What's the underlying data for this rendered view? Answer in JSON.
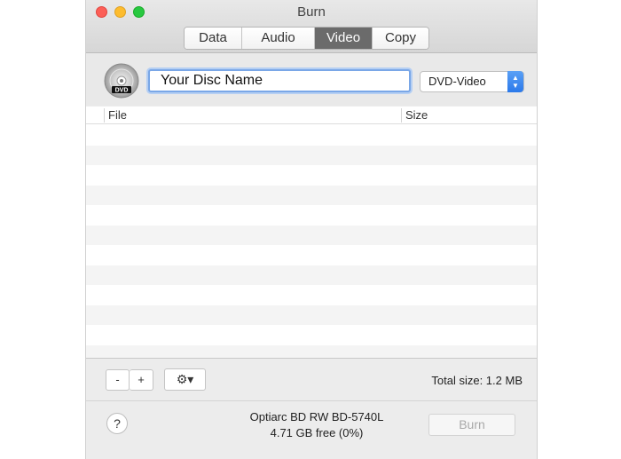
{
  "window": {
    "title": "Burn"
  },
  "tabs": [
    {
      "label": "Data"
    },
    {
      "label": "Audio"
    },
    {
      "label": "Video"
    },
    {
      "label": "Copy"
    }
  ],
  "active_tab": "Video",
  "disc": {
    "name_value": "Your Disc Name",
    "icon_label": "DVD",
    "type_selected": "DVD-Video"
  },
  "table": {
    "columns": [
      "File",
      "Size"
    ],
    "rows": []
  },
  "toolbar": {
    "remove_label": "-",
    "add_label": "+",
    "gear_label": "⚙▾",
    "total_size": "Total size: 1.2 MB"
  },
  "footer": {
    "help_label": "?",
    "drive_name": "Optiarc BD RW BD-5740L",
    "drive_free": "4.71 GB free (0%)",
    "burn_label": "Burn"
  },
  "colors": {
    "accent": "#2b79ea",
    "active_tab": "#6b6b6b",
    "focus_ring": "#7aa7e7"
  }
}
